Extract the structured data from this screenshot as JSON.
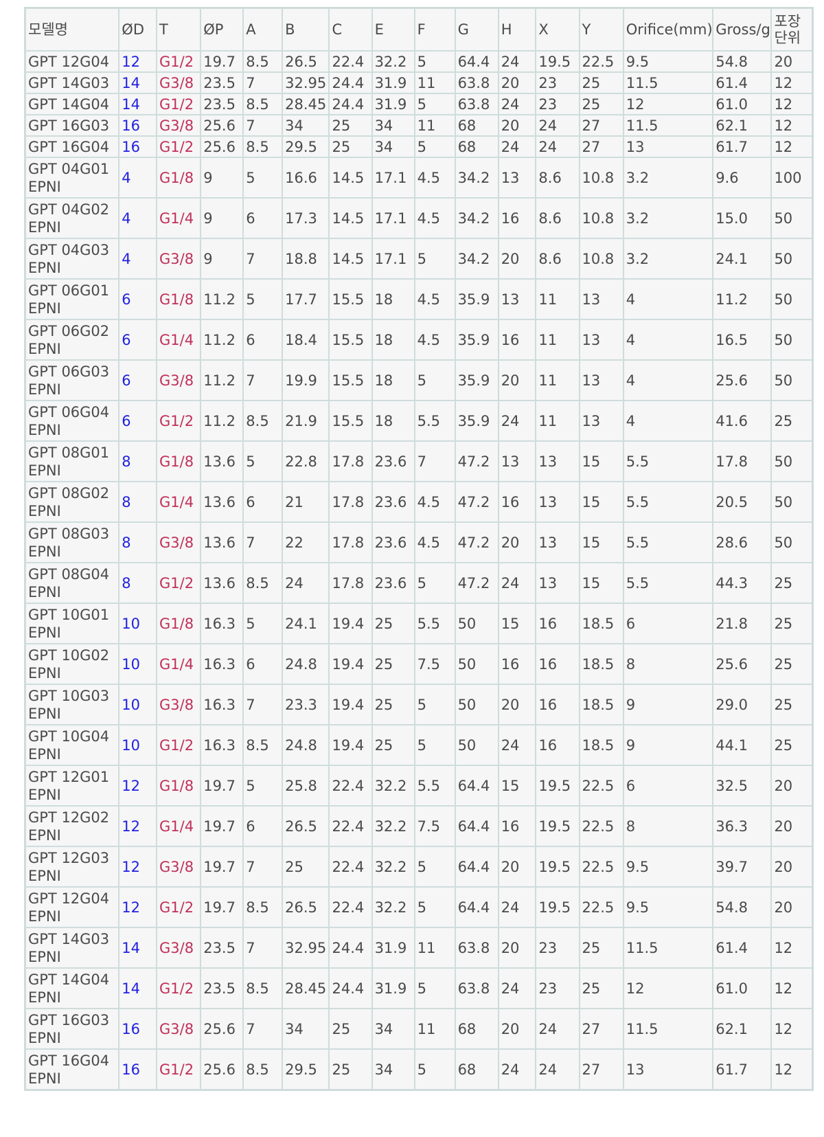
{
  "table": {
    "headers": [
      "모델명",
      "ØD",
      "T",
      "ØP",
      "A",
      "B",
      "C",
      "E",
      "F",
      "G",
      "H",
      "X",
      "Y",
      "Orifice(mm)",
      "Gross/g",
      "포장단위"
    ],
    "colors": {
      "od": "#1f1fe0",
      "thread": "#c0305a",
      "text": "#4a4a4a",
      "border": "#cfdcdc",
      "background": "#f6f6f6"
    },
    "rows": [
      [
        "GPT 12G04",
        "12",
        "G1/2",
        "19.7",
        "8.5",
        "26.5",
        "22.4",
        "32.2",
        "5",
        "64.4",
        "24",
        "19.5",
        "22.5",
        "9.5",
        "54.8",
        "20"
      ],
      [
        "GPT 14G03",
        "14",
        "G3/8",
        "23.5",
        "7",
        "32.95",
        "24.4",
        "31.9",
        "11",
        "63.8",
        "20",
        "23",
        "25",
        "11.5",
        "61.4",
        "12"
      ],
      [
        "GPT 14G04",
        "14",
        "G1/2",
        "23.5",
        "8.5",
        "28.45",
        "24.4",
        "31.9",
        "5",
        "63.8",
        "24",
        "23",
        "25",
        "12",
        "61.0",
        "12"
      ],
      [
        "GPT 16G03",
        "16",
        "G3/8",
        "25.6",
        "7",
        "34",
        "25",
        "34",
        "11",
        "68",
        "20",
        "24",
        "27",
        "11.5",
        "62.1",
        "12"
      ],
      [
        "GPT 16G04",
        "16",
        "G1/2",
        "25.6",
        "8.5",
        "29.5",
        "25",
        "34",
        "5",
        "68",
        "24",
        "24",
        "27",
        "13",
        "61.7",
        "12"
      ],
      [
        "GPT 04G01 EPNI",
        "4",
        "G1/8",
        "9",
        "5",
        "16.6",
        "14.5",
        "17.1",
        "4.5",
        "34.2",
        "13",
        "8.6",
        "10.8",
        "3.2",
        "9.6",
        "100"
      ],
      [
        "GPT 04G02 EPNI",
        "4",
        "G1/4",
        "9",
        "6",
        "17.3",
        "14.5",
        "17.1",
        "4.5",
        "34.2",
        "16",
        "8.6",
        "10.8",
        "3.2",
        "15.0",
        "50"
      ],
      [
        "GPT 04G03 EPNI",
        "4",
        "G3/8",
        "9",
        "7",
        "18.8",
        "14.5",
        "17.1",
        "5",
        "34.2",
        "20",
        "8.6",
        "10.8",
        "3.2",
        "24.1",
        "50"
      ],
      [
        "GPT 06G01 EPNI",
        "6",
        "G1/8",
        "11.2",
        "5",
        "17.7",
        "15.5",
        "18",
        "4.5",
        "35.9",
        "13",
        "11",
        "13",
        "4",
        "11.2",
        "50"
      ],
      [
        "GPT 06G02 EPNI",
        "6",
        "G1/4",
        "11.2",
        "6",
        "18.4",
        "15.5",
        "18",
        "4.5",
        "35.9",
        "16",
        "11",
        "13",
        "4",
        "16.5",
        "50"
      ],
      [
        "GPT 06G03 EPNI",
        "6",
        "G3/8",
        "11.2",
        "7",
        "19.9",
        "15.5",
        "18",
        "5",
        "35.9",
        "20",
        "11",
        "13",
        "4",
        "25.6",
        "50"
      ],
      [
        "GPT 06G04 EPNI",
        "6",
        "G1/2",
        "11.2",
        "8.5",
        "21.9",
        "15.5",
        "18",
        "5.5",
        "35.9",
        "24",
        "11",
        "13",
        "4",
        "41.6",
        "25"
      ],
      [
        "GPT 08G01 EPNI",
        "8",
        "G1/8",
        "13.6",
        "5",
        "22.8",
        "17.8",
        "23.6",
        "7",
        "47.2",
        "13",
        "13",
        "15",
        "5.5",
        "17.8",
        "50"
      ],
      [
        "GPT 08G02 EPNI",
        "8",
        "G1/4",
        "13.6",
        "6",
        "21",
        "17.8",
        "23.6",
        "4.5",
        "47.2",
        "16",
        "13",
        "15",
        "5.5",
        "20.5",
        "50"
      ],
      [
        "GPT 08G03 EPNI",
        "8",
        "G3/8",
        "13.6",
        "7",
        "22",
        "17.8",
        "23.6",
        "4.5",
        "47.2",
        "20",
        "13",
        "15",
        "5.5",
        "28.6",
        "50"
      ],
      [
        "GPT 08G04 EPNI",
        "8",
        "G1/2",
        "13.6",
        "8.5",
        "24",
        "17.8",
        "23.6",
        "5",
        "47.2",
        "24",
        "13",
        "15",
        "5.5",
        "44.3",
        "25"
      ],
      [
        "GPT 10G01 EPNI",
        "10",
        "G1/8",
        "16.3",
        "5",
        "24.1",
        "19.4",
        "25",
        "5.5",
        "50",
        "15",
        "16",
        "18.5",
        "6",
        "21.8",
        "25"
      ],
      [
        "GPT 10G02 EPNI",
        "10",
        "G1/4",
        "16.3",
        "6",
        "24.8",
        "19.4",
        "25",
        "7.5",
        "50",
        "16",
        "16",
        "18.5",
        "8",
        "25.6",
        "25"
      ],
      [
        "GPT 10G03 EPNI",
        "10",
        "G3/8",
        "16.3",
        "7",
        "23.3",
        "19.4",
        "25",
        "5",
        "50",
        "20",
        "16",
        "18.5",
        "9",
        "29.0",
        "25"
      ],
      [
        "GPT 10G04 EPNI",
        "10",
        "G1/2",
        "16.3",
        "8.5",
        "24.8",
        "19.4",
        "25",
        "5",
        "50",
        "24",
        "16",
        "18.5",
        "9",
        "44.1",
        "25"
      ],
      [
        "GPT 12G01 EPNI",
        "12",
        "G1/8",
        "19.7",
        "5",
        "25.8",
        "22.4",
        "32.2",
        "5.5",
        "64.4",
        "15",
        "19.5",
        "22.5",
        "6",
        "32.5",
        "20"
      ],
      [
        "GPT 12G02 EPNI",
        "12",
        "G1/4",
        "19.7",
        "6",
        "26.5",
        "22.4",
        "32.2",
        "7.5",
        "64.4",
        "16",
        "19.5",
        "22.5",
        "8",
        "36.3",
        "20"
      ],
      [
        "GPT 12G03 EPNI",
        "12",
        "G3/8",
        "19.7",
        "7",
        "25",
        "22.4",
        "32.2",
        "5",
        "64.4",
        "20",
        "19.5",
        "22.5",
        "9.5",
        "39.7",
        "20"
      ],
      [
        "GPT 12G04 EPNI",
        "12",
        "G1/2",
        "19.7",
        "8.5",
        "26.5",
        "22.4",
        "32.2",
        "5",
        "64.4",
        "24",
        "19.5",
        "22.5",
        "9.5",
        "54.8",
        "20"
      ],
      [
        "GPT 14G03 EPNI",
        "14",
        "G3/8",
        "23.5",
        "7",
        "32.95",
        "24.4",
        "31.9",
        "11",
        "63.8",
        "20",
        "23",
        "25",
        "11.5",
        "61.4",
        "12"
      ],
      [
        "GPT 14G04 EPNI",
        "14",
        "G1/2",
        "23.5",
        "8.5",
        "28.45",
        "24.4",
        "31.9",
        "5",
        "63.8",
        "24",
        "23",
        "25",
        "12",
        "61.0",
        "12"
      ],
      [
        "GPT 16G03 EPNI",
        "16",
        "G3/8",
        "25.6",
        "7",
        "34",
        "25",
        "34",
        "11",
        "68",
        "20",
        "24",
        "27",
        "11.5",
        "62.1",
        "12"
      ],
      [
        "GPT 16G04 EPNI",
        "16",
        "G1/2",
        "25.6",
        "8.5",
        "29.5",
        "25",
        "34",
        "5",
        "68",
        "24",
        "24",
        "27",
        "13",
        "61.7",
        "12"
      ]
    ]
  }
}
